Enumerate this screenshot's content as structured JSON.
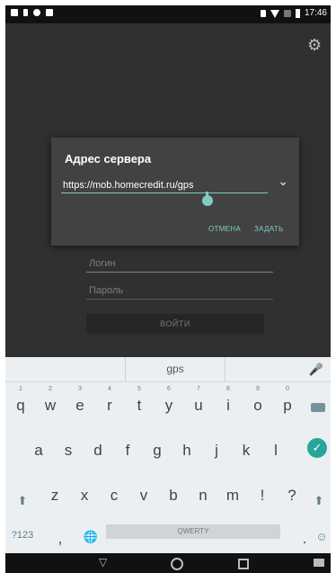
{
  "status_bar": {
    "time": "17:46"
  },
  "dialog": {
    "title": "Адрес сервера",
    "url_value": "https://mob.homecredit.ru/gps",
    "cancel_label": "ОТМЕНА",
    "set_label": "ЗАДАТЬ"
  },
  "login": {
    "login_placeholder": "Логин",
    "password_placeholder": "Пароль",
    "submit_label": "ВОЙТИ"
  },
  "keyboard": {
    "suggestion": "gps",
    "row1": [
      {
        "ch": "q",
        "num": "1"
      },
      {
        "ch": "w",
        "num": "2"
      },
      {
        "ch": "e",
        "num": "3"
      },
      {
        "ch": "r",
        "num": "4"
      },
      {
        "ch": "t",
        "num": "5"
      },
      {
        "ch": "y",
        "num": "6"
      },
      {
        "ch": "u",
        "num": "7"
      },
      {
        "ch": "i",
        "num": "8"
      },
      {
        "ch": "o",
        "num": "9"
      },
      {
        "ch": "p",
        "num": "0"
      }
    ],
    "row2": [
      "a",
      "s",
      "d",
      "f",
      "g",
      "h",
      "j",
      "k",
      "l"
    ],
    "row3": [
      "z",
      "x",
      "c",
      "v",
      "b",
      "n",
      "m",
      "!",
      "?"
    ],
    "symbols_label": "?123",
    "comma": ",",
    "space_label": "QWERTY",
    "period": "."
  }
}
